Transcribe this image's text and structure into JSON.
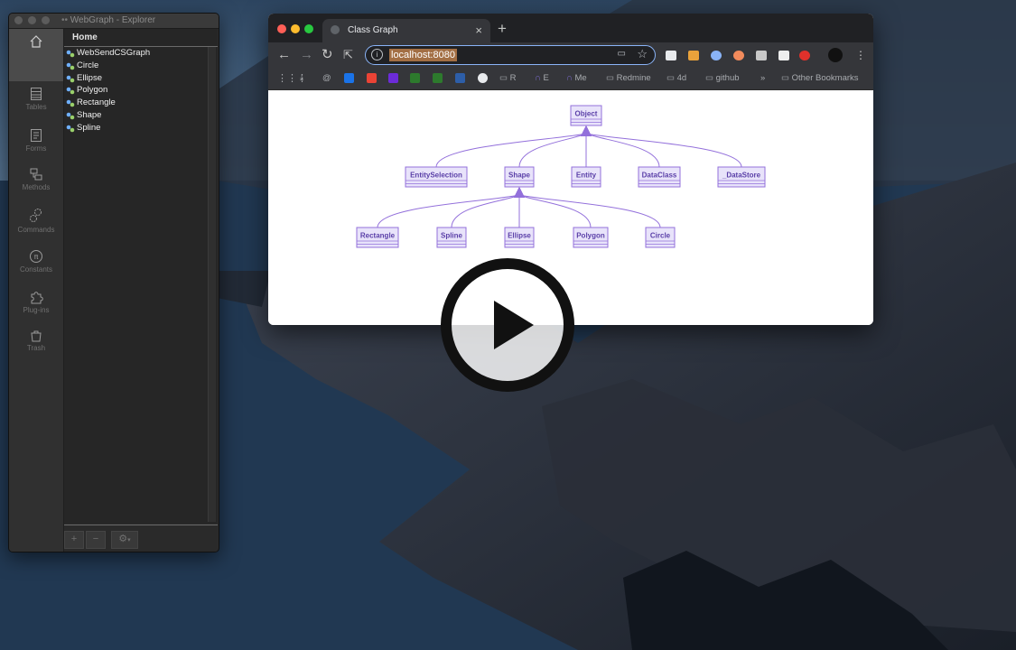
{
  "explorer": {
    "title": "WebGraph - Explorer",
    "sidebar": [
      {
        "label": "Tables",
        "icon": "tables-icon"
      },
      {
        "label": "Forms",
        "icon": "forms-icon"
      },
      {
        "label": "Methods",
        "icon": "methods-icon"
      },
      {
        "label": "Commands",
        "icon": "commands-icon"
      },
      {
        "label": "Constants",
        "icon": "constants-icon"
      },
      {
        "label": "Plug-ins",
        "icon": "plugins-icon"
      },
      {
        "label": "Trash",
        "icon": "trash-icon"
      }
    ],
    "home_label": "Home",
    "classes": [
      "WebSendCSGraph",
      "Circle",
      "Ellipse",
      "Polygon",
      "Rectangle",
      "Shape",
      "Spline"
    ],
    "add_button": "+",
    "remove_button": "−"
  },
  "browser": {
    "tab_title": "Class Graph",
    "new_tab": "+",
    "close_tab": "×",
    "url": "localhost:8080",
    "bookmarks": [
      "R",
      "E",
      "Me",
      "Redmine",
      "4d",
      "github"
    ],
    "overflow": "»",
    "other_bookmarks": "Other Bookmarks"
  },
  "diagram": {
    "nodes": [
      "Object",
      "EntitySelection",
      "Shape",
      "Entity",
      "DataClass",
      "_DataStore",
      "Rectangle",
      "Spline",
      "Ellipse",
      "Polygon",
      "Circle"
    ],
    "edges": [
      [
        "EntitySelection",
        "Object"
      ],
      [
        "Shape",
        "Object"
      ],
      [
        "Entity",
        "Object"
      ],
      [
        "DataClass",
        "Object"
      ],
      [
        "_DataStore",
        "Object"
      ],
      [
        "Rectangle",
        "Shape"
      ],
      [
        "Spline",
        "Shape"
      ],
      [
        "Ellipse",
        "Shape"
      ],
      [
        "Polygon",
        "Shape"
      ],
      [
        "Circle",
        "Shape"
      ]
    ],
    "node_color": "#e8e3fa",
    "stroke_color": "#9370db",
    "text_color": "#5a3fa8"
  },
  "video": {
    "play_icon": "play-icon"
  }
}
